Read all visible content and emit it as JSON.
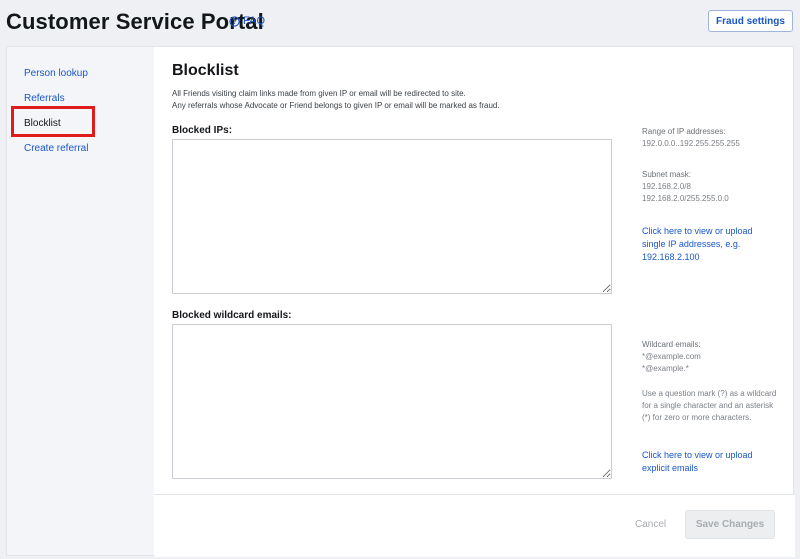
{
  "header": {
    "title": "Customer Service Portal",
    "faq_label": "FAQ",
    "fraud_settings_label": "Fraud settings"
  },
  "sidebar": {
    "items": [
      {
        "label": "Person lookup"
      },
      {
        "label": "Referrals"
      },
      {
        "label": "Blocklist",
        "active": true
      },
      {
        "label": "Create referral"
      }
    ]
  },
  "main": {
    "title": "Blocklist",
    "description_lines": [
      "All Friends visiting claim links made from given IP or email will be redirected to site.",
      "Any referrals whose Advocate or Friend belongs to given IP or email will be marked as fraud."
    ],
    "blocked_ips": {
      "label": "Blocked IPs:",
      "value": ""
    },
    "blocked_emails": {
      "label": "Blocked wildcard emails:",
      "value": ""
    },
    "ip_hints": {
      "range_label": "Range of IP addresses:",
      "range_value": "192.0.0.0..192.255.255.255",
      "subnet_label": "Subnet mask:",
      "subnet_values": [
        "192.168.2.0/8",
        "192.168.2.0/255.255.0.0"
      ],
      "link": "Click here to view or upload single IP addresses, e.g. 192.168.2.100"
    },
    "email_hints": {
      "label": "Wildcard emails:",
      "examples": [
        "*@example.com",
        "*@example.*"
      ],
      "explanation": "Use a question mark (?) as a wildcard for a single character and an asterisk (*) for zero or more characters.",
      "link": "Click here to view or upload explicit emails"
    }
  },
  "footer": {
    "cancel_label": "Cancel",
    "save_label": "Save Changes"
  },
  "colors": {
    "accent": "#1a56c8",
    "highlight": "#e01b1b",
    "sidebar_bg": "#f3f5f8"
  }
}
